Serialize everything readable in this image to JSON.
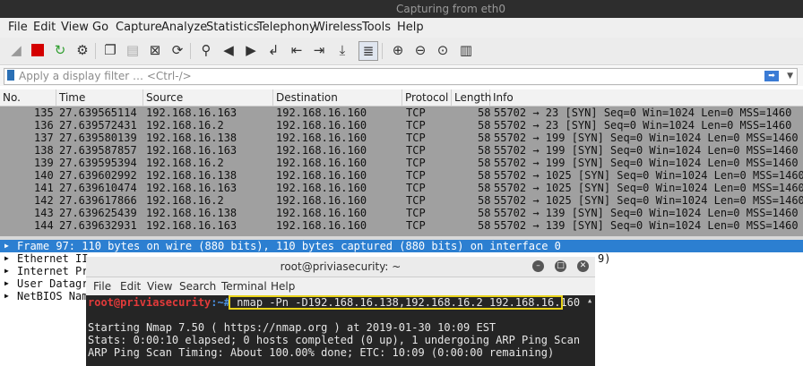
{
  "window": {
    "title": "Capturing from eth0"
  },
  "menu": [
    "File",
    "Edit",
    "View",
    "Go",
    "Capture",
    "Analyze",
    "Statistics",
    "Telephony",
    "Wireless",
    "Tools",
    "Help"
  ],
  "toolbar_icons": [
    "shark-fin-start-icon",
    "stop-capture-icon",
    "restart-capture-icon",
    "capture-options-icon",
    "open-file-icon",
    "save-file-icon",
    "close-file-icon",
    "reload-icon",
    "find-packet-icon",
    "go-back-icon",
    "go-forward-icon",
    "go-to-packet-icon",
    "first-packet-icon",
    "last-packet-icon",
    "auto-scroll-icon",
    "colorize-icon",
    "zoom-in-icon",
    "zoom-out-icon",
    "normal-size-icon",
    "resize-columns-icon"
  ],
  "filter": {
    "placeholder": "Apply a display filter … <Ctrl-/>"
  },
  "columns": [
    "No.",
    "Time",
    "Source",
    "Destination",
    "Protocol",
    "Length",
    "Info"
  ],
  "packets": [
    {
      "no": "135",
      "time": "27.639565114",
      "source": "192.168.16.163",
      "destination": "192.168.16.160",
      "protocol": "TCP",
      "length": "58",
      "info": "55702 → 23 [SYN] Seq=0 Win=1024 Len=0 MSS=1460"
    },
    {
      "no": "136",
      "time": "27.639572431",
      "source": "192.168.16.2",
      "destination": "192.168.16.160",
      "protocol": "TCP",
      "length": "58",
      "info": "55702 → 23 [SYN] Seq=0 Win=1024 Len=0 MSS=1460"
    },
    {
      "no": "137",
      "time": "27.639580139",
      "source": "192.168.16.138",
      "destination": "192.168.16.160",
      "protocol": "TCP",
      "length": "58",
      "info": "55702 → 199 [SYN] Seq=0 Win=1024 Len=0 MSS=1460"
    },
    {
      "no": "138",
      "time": "27.639587857",
      "source": "192.168.16.163",
      "destination": "192.168.16.160",
      "protocol": "TCP",
      "length": "58",
      "info": "55702 → 199 [SYN] Seq=0 Win=1024 Len=0 MSS=1460"
    },
    {
      "no": "139",
      "time": "27.639595394",
      "source": "192.168.16.2",
      "destination": "192.168.16.160",
      "protocol": "TCP",
      "length": "58",
      "info": "55702 → 199 [SYN] Seq=0 Win=1024 Len=0 MSS=1460"
    },
    {
      "no": "140",
      "time": "27.639602992",
      "source": "192.168.16.138",
      "destination": "192.168.16.160",
      "protocol": "TCP",
      "length": "58",
      "info": "55702 → 1025 [SYN] Seq=0 Win=1024 Len=0 MSS=1460"
    },
    {
      "no": "141",
      "time": "27.639610474",
      "source": "192.168.16.163",
      "destination": "192.168.16.160",
      "protocol": "TCP",
      "length": "58",
      "info": "55702 → 1025 [SYN] Seq=0 Win=1024 Len=0 MSS=1460"
    },
    {
      "no": "142",
      "time": "27.639617866",
      "source": "192.168.16.2",
      "destination": "192.168.16.160",
      "protocol": "TCP",
      "length": "58",
      "info": "55702 → 1025 [SYN] Seq=0 Win=1024 Len=0 MSS=1460"
    },
    {
      "no": "143",
      "time": "27.639625439",
      "source": "192.168.16.138",
      "destination": "192.168.16.160",
      "protocol": "TCP",
      "length": "58",
      "info": "55702 → 139 [SYN] Seq=0 Win=1024 Len=0 MSS=1460"
    },
    {
      "no": "144",
      "time": "27.639632931",
      "source": "192.168.16.163",
      "destination": "192.168.16.160",
      "protocol": "TCP",
      "length": "58",
      "info": "55702 → 139 [SYN] Seq=0 Win=1024 Len=0 MSS=1460"
    }
  ],
  "details": [
    {
      "text": "Frame 97: 110 bytes on wire (880 bits), 110 bytes captured (880 bits) on interface 0",
      "tail": ""
    },
    {
      "text": "Ethernet II",
      "tail": "9)"
    },
    {
      "text": "Internet Pr",
      "tail": ""
    },
    {
      "text": "User Datagra",
      "tail": ""
    },
    {
      "text": "NetBIOS Name",
      "tail": ""
    }
  ],
  "terminal": {
    "title": "root@priviasecurity: ~",
    "menu": [
      "File",
      "Edit",
      "View",
      "Search",
      "Terminal",
      "Help"
    ],
    "prompt_user": "root@priviasecurity",
    "prompt_path": ":~#",
    "command": "nmap -Pn -D192.168.16.138,192.168.16.2 192.168.16.160",
    "output": [
      "Starting Nmap 7.50 ( https://nmap.org ) at 2019-01-30 10:09 EST",
      "Stats: 0:00:10 elapsed; 0 hosts completed (0 up), 1 undergoing ARP Ping Scan",
      "ARP Ping Scan Timing: About 100.00% done; ETC: 10:09 (0:00:00 remaining)"
    ]
  },
  "colors": {
    "packet_row_bg": "#a0a0a0",
    "selected_detail_bg": "#2c7fd1",
    "terminal_bg": "#252525",
    "command_highlight": "#e8d21a",
    "prompt_user": "#e23a3a",
    "prompt_path": "#4a8fe0"
  }
}
